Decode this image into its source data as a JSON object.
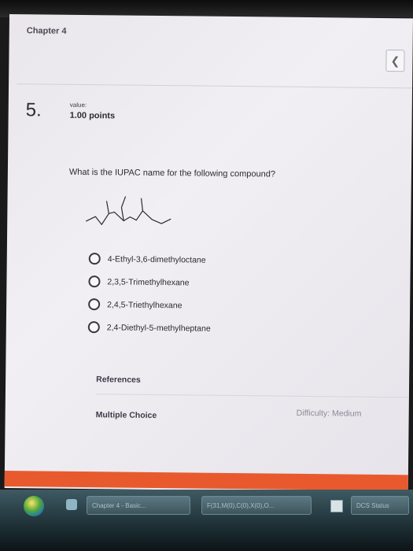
{
  "header": {
    "chapter": "Chapter 4",
    "back_icon": "chevron-left-icon"
  },
  "question": {
    "number": "5.",
    "value_label": "value:",
    "points": "1.00 points",
    "prompt": "What is the IUPAC name for the following compound?"
  },
  "options": [
    {
      "label": "4-Ethyl-3,6-dimethyloctane"
    },
    {
      "label": "2,3,5-Trimethylhexane"
    },
    {
      "label": "2,4,5-Triethylhexane"
    },
    {
      "label": "2,4-Diethyl-5-methylheptane"
    }
  ],
  "footer": {
    "references": "References",
    "question_type": "Multiple Choice",
    "difficulty": "Difficulty: Medium"
  },
  "taskbar": {
    "item1": "Chapter 4 - Basic...",
    "item2": "F(31,M(0),C(0),X(0),O...",
    "item3": "DCS Status"
  },
  "colors": {
    "accent_bar": "#e85a2e"
  }
}
